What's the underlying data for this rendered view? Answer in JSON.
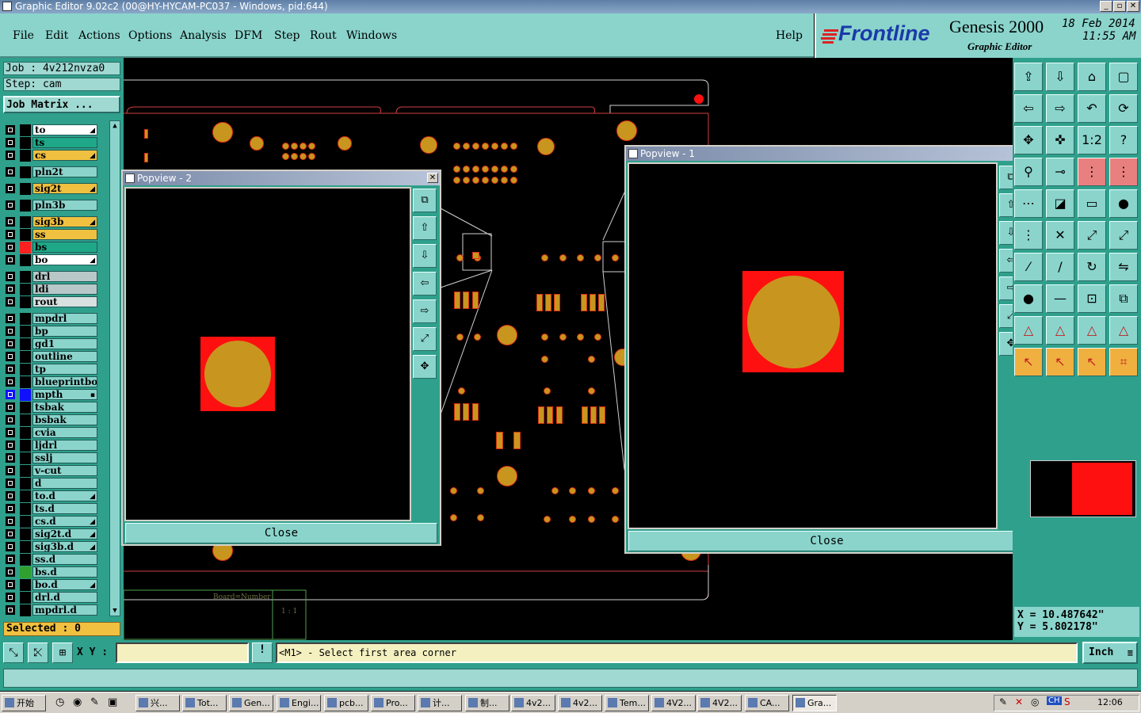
{
  "window": {
    "title": "Graphic Editor 9.02c2 (00@HY-HYCAM-PC037 - Windows, pid:644)",
    "btn_min": "_",
    "btn_max": "▫",
    "btn_close": "✕"
  },
  "menu": {
    "items": [
      "File",
      "Edit",
      "Actions",
      "Options",
      "Analysis",
      "DFM",
      "Step",
      "Rout",
      "Windows"
    ],
    "help": "Help"
  },
  "brand": {
    "logo": "Frontline",
    "product": "Genesis 2000",
    "subtitle": "Graphic Editor",
    "date": "18 Feb 2014",
    "time": "11:55 AM"
  },
  "job": {
    "job_label": "Job : 4v212nvza0",
    "step_label": "Step: cam",
    "matrix_button": "Job Matrix ..."
  },
  "layers": [
    {
      "name": "to",
      "color": "#ffffff",
      "arrow": true
    },
    {
      "name": "ts",
      "color": "#1fa888",
      "arrow": false
    },
    {
      "name": "cs",
      "color": "#f0c040",
      "arrow": true
    },
    {
      "name": "pln2t",
      "color": "#8ad4cc",
      "arrow": false
    },
    {
      "name": "sig2t",
      "color": "#f0c040",
      "arrow": true
    },
    {
      "name": "pln3b",
      "color": "#8ad4cc",
      "arrow": false
    },
    {
      "name": "sig3b",
      "color": "#f0c040",
      "arrow": true
    },
    {
      "name": "ss",
      "color": "#f0c040",
      "arrow": false
    },
    {
      "name": "bs",
      "color": "#1fa888",
      "arrow": false,
      "swatch": "#ff2020"
    },
    {
      "name": "bo",
      "color": "#ffffff",
      "arrow": true
    },
    {
      "name": "drl",
      "color": "#b8c8c8",
      "arrow": false
    },
    {
      "name": "ldi",
      "color": "#b8c8c8",
      "arrow": false
    },
    {
      "name": "rout",
      "color": "#d8e0e0",
      "arrow": false
    },
    {
      "name": "mpdrl",
      "color": "#8ad4cc",
      "arrow": false
    },
    {
      "name": "bp",
      "color": "#8ad4cc",
      "arrow": false
    },
    {
      "name": "gd1",
      "color": "#8ad4cc",
      "arrow": false
    },
    {
      "name": "outline",
      "color": "#8ad4cc",
      "arrow": false
    },
    {
      "name": "tp",
      "color": "#8ad4cc",
      "arrow": false
    },
    {
      "name": "blueprintbot",
      "color": "#8ad4cc",
      "arrow": false
    },
    {
      "name": "mpth",
      "color": "#8ad4cc",
      "arrow": false,
      "swatch": "#1010ff",
      "checkbg": "#1010ff",
      "dots": true
    },
    {
      "name": "tsbak",
      "color": "#8ad4cc",
      "arrow": false
    },
    {
      "name": "bsbak",
      "color": "#8ad4cc",
      "arrow": false
    },
    {
      "name": "cvia",
      "color": "#8ad4cc",
      "arrow": false
    },
    {
      "name": "ljdrl",
      "color": "#8ad4cc",
      "arrow": false
    },
    {
      "name": "sslj",
      "color": "#8ad4cc",
      "arrow": false
    },
    {
      "name": "v-cut",
      "color": "#8ad4cc",
      "arrow": false
    },
    {
      "name": "d",
      "color": "#8ad4cc",
      "arrow": false
    },
    {
      "name": "to.d",
      "color": "#8ad4cc",
      "arrow": true
    },
    {
      "name": "ts.d",
      "color": "#8ad4cc",
      "arrow": false
    },
    {
      "name": "cs.d",
      "color": "#8ad4cc",
      "arrow": true
    },
    {
      "name": "sig2t.d",
      "color": "#8ad4cc",
      "arrow": true
    },
    {
      "name": "sig3b.d",
      "color": "#8ad4cc",
      "arrow": true
    },
    {
      "name": "ss.d",
      "color": "#8ad4cc",
      "arrow": false
    },
    {
      "name": "bs.d",
      "color": "#8ad4cc",
      "arrow": false,
      "swatch": "#30a030"
    },
    {
      "name": "bo.d",
      "color": "#8ad4cc",
      "arrow": true
    },
    {
      "name": "drl.d",
      "color": "#8ad4cc",
      "arrow": false
    },
    {
      "name": "mpdrl.d",
      "color": "#8ad4cc",
      "arrow": false
    }
  ],
  "selected_label": "Selected : 0",
  "canvas": {
    "board_text": "Board=Number",
    "scale_text": "1 : 1"
  },
  "popview2": {
    "title": "Popview - 2",
    "close": "Close"
  },
  "popview1": {
    "title": "Popview - 1",
    "close": "Close"
  },
  "coords": {
    "x": "X = 10.487642\"",
    "y": "Y = 5.802178\""
  },
  "cmd": {
    "xy_label": "X Y :",
    "xy_value": "",
    "prompt": "<M1> - Select first area corner",
    "unit": "Inch",
    "bang": "!"
  },
  "taskbar": {
    "start": "开始",
    "tasks": [
      "兴...",
      "Tot...",
      "Gen...",
      "Engi...",
      "pcb...",
      "Pro...",
      "计...",
      "制...",
      "4v2...",
      "4v2...",
      "Tem...",
      "4V2...",
      "4V2...",
      "CA...",
      "Gra..."
    ],
    "tray_lang": "CH",
    "clock": "12:06"
  }
}
